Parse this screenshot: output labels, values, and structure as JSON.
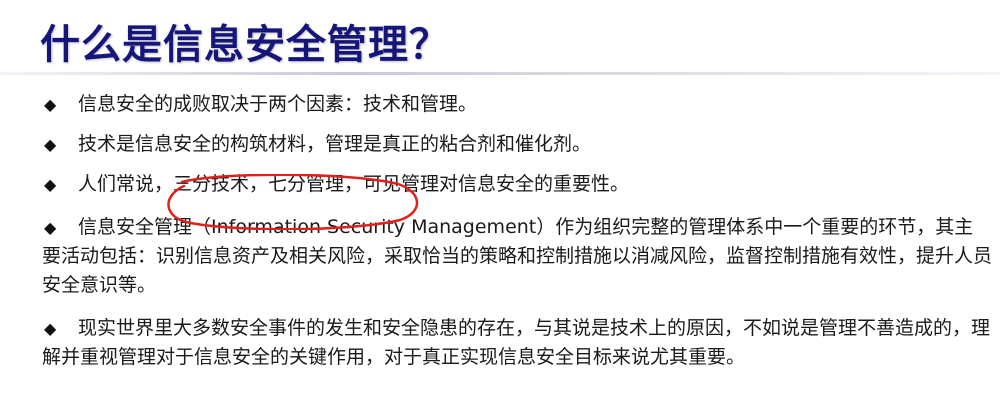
{
  "slide": {
    "title": "什么是信息安全管理？",
    "bullets": [
      {
        "text": "信息安全的成败取决于两个因素：技术和管理。"
      },
      {
        "text": "技术是信息安全的构筑材料，管理是真正的粘合剂和催化剂。"
      },
      {
        "before": "人们常说，",
        "highlight": "三分技术，七分管理，",
        "after": "可见管理对信息安全的重要性。"
      },
      {
        "text": "信息安全管理（Information Security Management）作为组织完整的管理体系中一个重要的环节，其主要活动包括：识别信息资产及相关风险，采取恰当的策略和控制措施以消减风险，监督控制措施有效性，提升人员安全意识等。"
      },
      {
        "text": "现实世界里大多数安全事件的发生和安全隐患的存在，与其说是技术上的原因，不如说是管理不善造成的，理解并重视管理对于信息安全的关键作用，对于真正实现信息安全目标来说尤其重要。"
      }
    ],
    "bullet_glyph": "◆",
    "colors": {
      "title": "#16167a",
      "text": "#1a1a1a",
      "annotation": "#e0201a"
    }
  }
}
